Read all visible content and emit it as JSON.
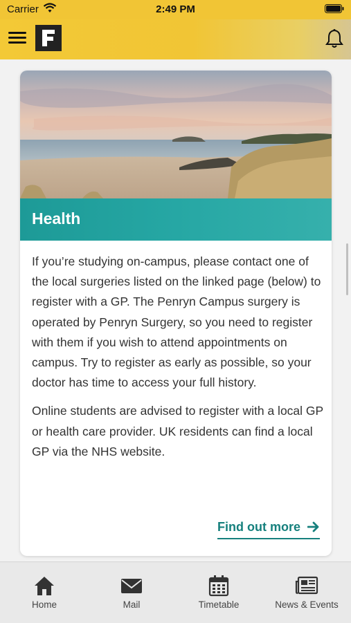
{
  "status_bar": {
    "carrier": "Carrier",
    "time": "2:49 PM"
  },
  "header": {
    "logo_letter": "F"
  },
  "card": {
    "title": "Health",
    "paragraphs": [
      "If you’re studying on-campus, please contact one of the local surgeries listed on the linked page (below) to register with a GP. The Penryn Campus surgery is operated by Penryn Surgery, so you need to register with them if you wish to attend appointments on campus. Try to register as early as possible, so your doctor has time to access your full history.",
      "Online students are advised to register with a local GP or health care provider. UK residents can find a local GP via the NHS website."
    ],
    "cta_label": "Find out more"
  },
  "tabs": [
    {
      "label": "Home",
      "icon": "home-icon"
    },
    {
      "label": "Mail",
      "icon": "mail-icon"
    },
    {
      "label": "Timetable",
      "icon": "calendar-icon"
    },
    {
      "label": "News & Events",
      "icon": "newspaper-icon"
    }
  ],
  "colors": {
    "header_yellow": "#f1c535",
    "teal": "#26a7a4",
    "link_teal": "#16807d"
  }
}
